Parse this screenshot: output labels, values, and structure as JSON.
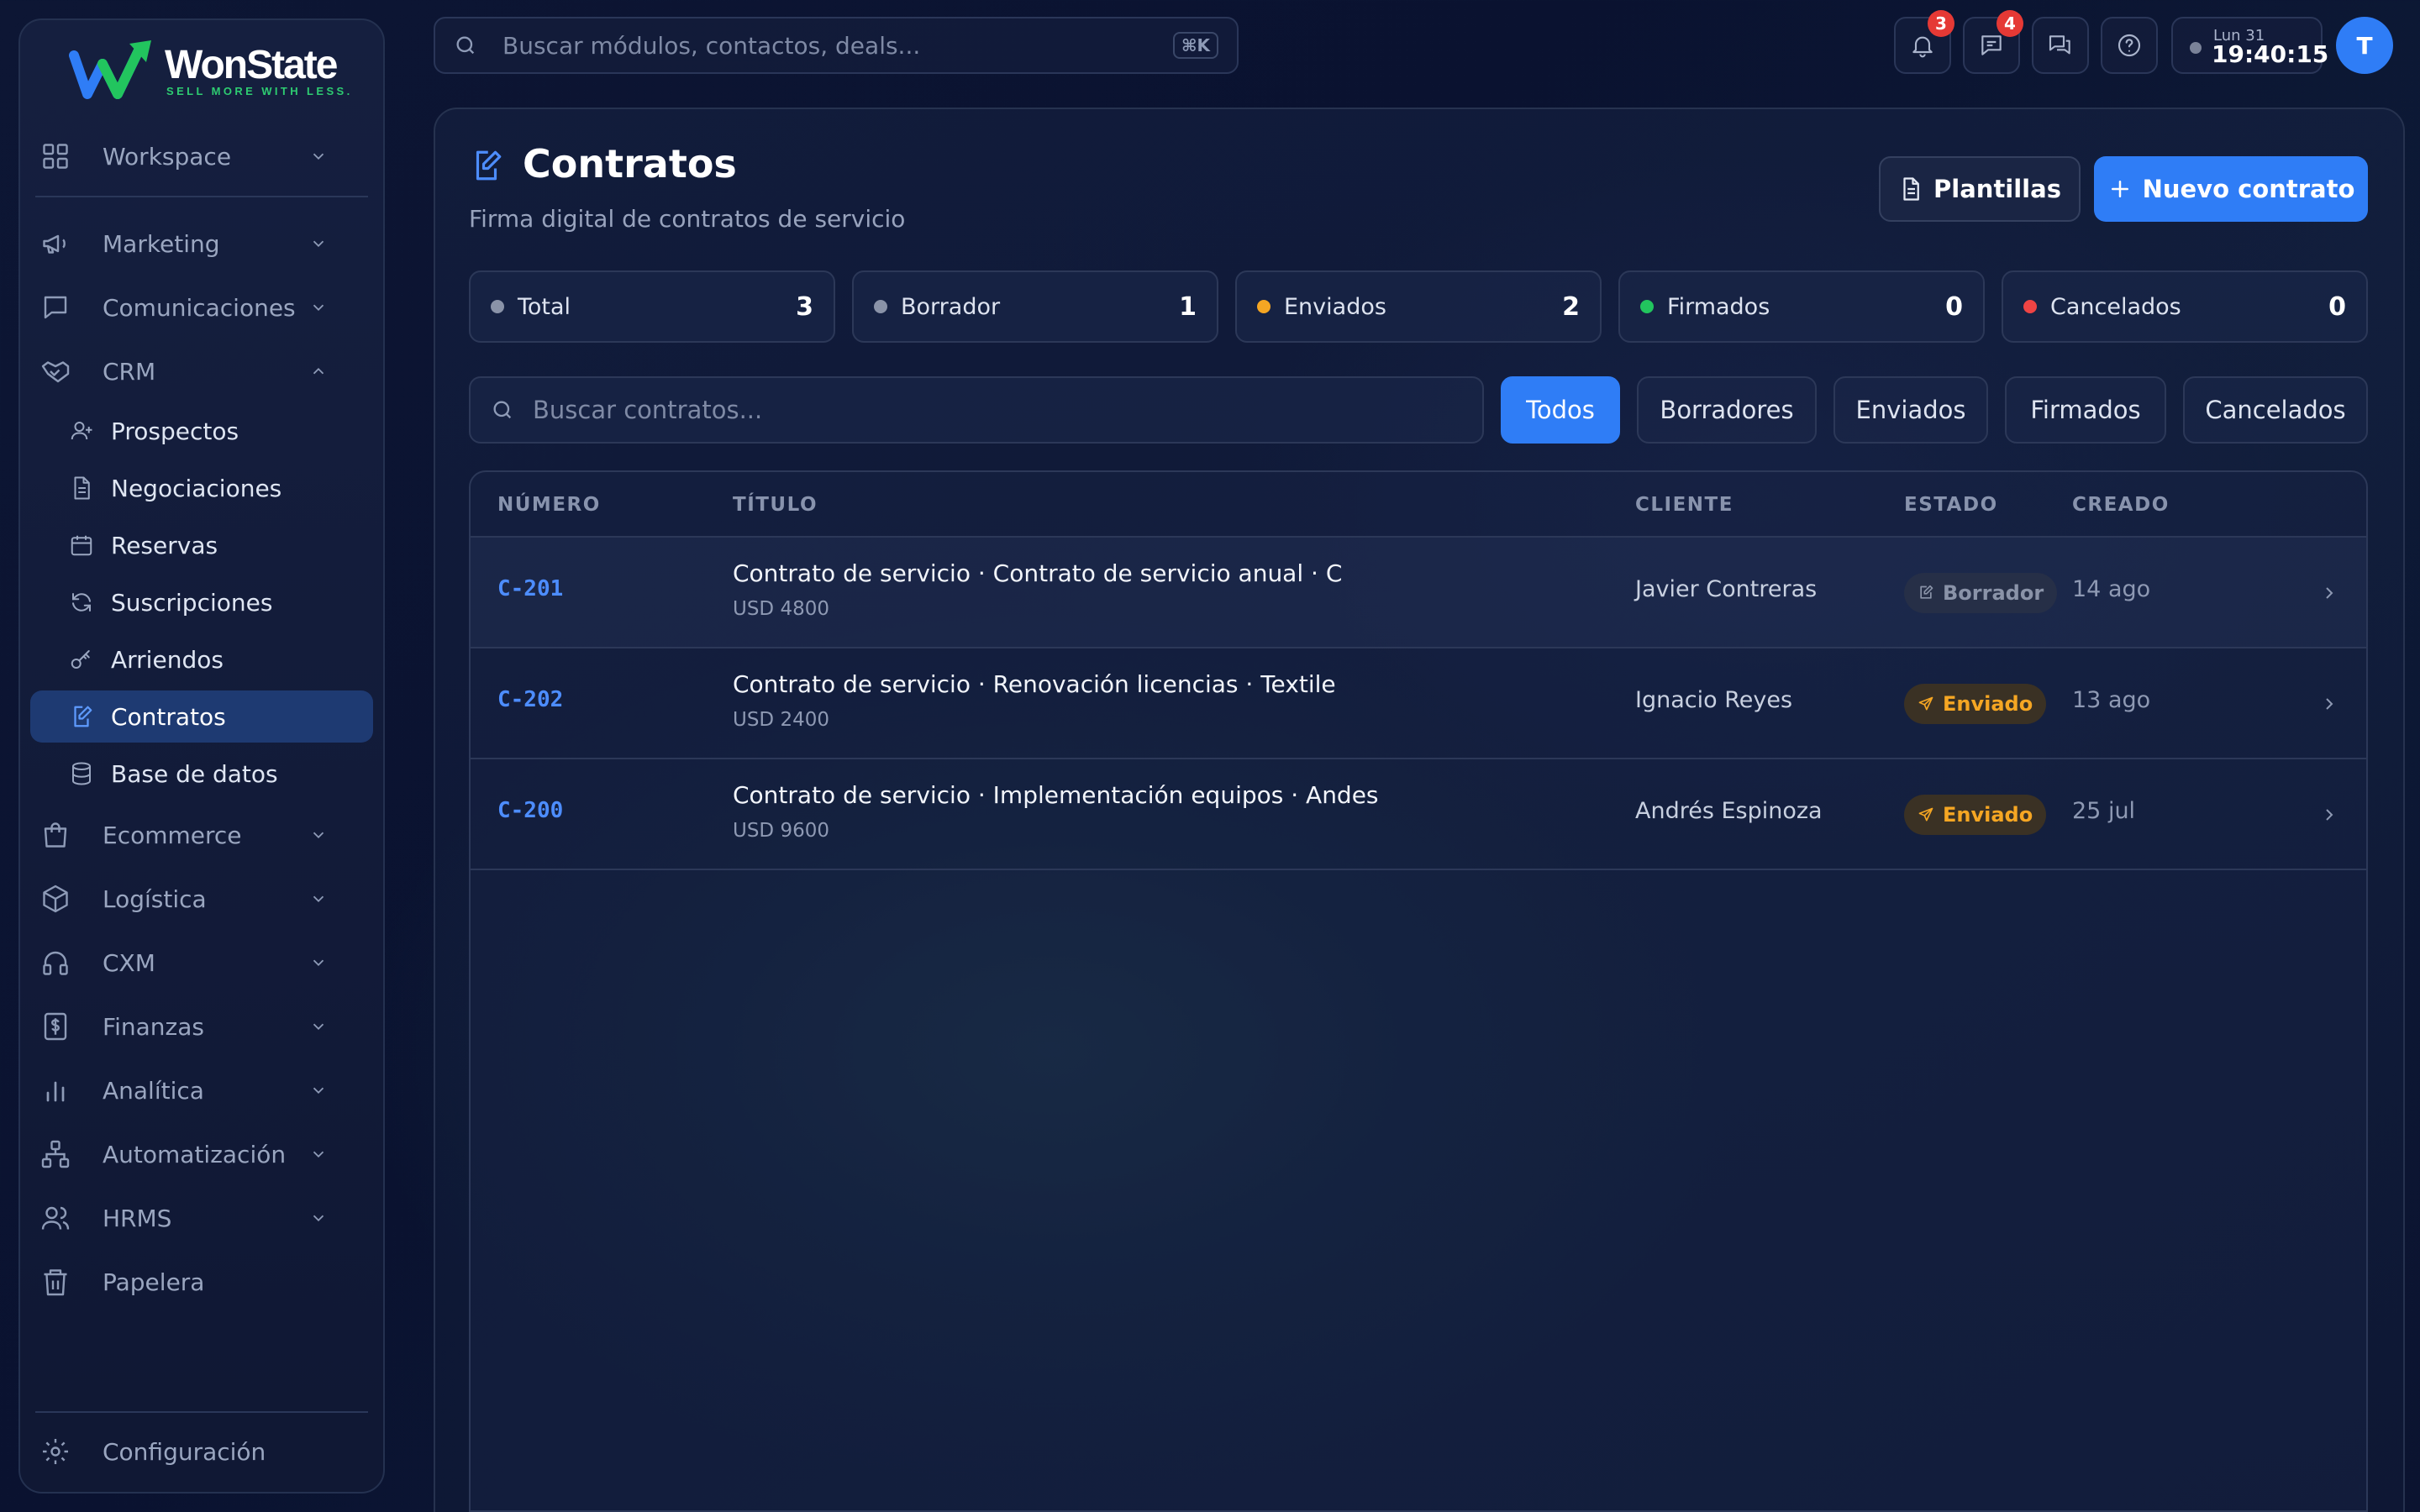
{
  "brand": {
    "name": "WonState",
    "tagline": "SELL MORE WITH LESS."
  },
  "colors": {
    "accent": "#2f7df6",
    "active_nav": "#1e3a72",
    "status_draft": "#8a93a8",
    "status_sent": "#f5a623",
    "status_signed": "#22c55e",
    "status_cancelled": "#ef4444",
    "badge": "#e53935"
  },
  "sidebar": {
    "workspace": "Workspace",
    "groups_top": [
      "Marketing",
      "Comunicaciones",
      "CRM"
    ],
    "crm_items": [
      "Prospectos",
      "Negociaciones",
      "Reservas",
      "Suscripciones",
      "Arriendos",
      "Contratos",
      "Base de datos"
    ],
    "groups_bottom": [
      "Ecommerce",
      "Logística",
      "CXM",
      "Finanzas",
      "Analítica",
      "Automatización",
      "HRMS",
      "Papelera"
    ],
    "settings": "Configuración",
    "active_item": "Contratos"
  },
  "topbar": {
    "search_placeholder": "Buscar módulos, contactos, deals...",
    "shortcut": "⌘K",
    "notifications_count": "3",
    "messages_count": "4",
    "clock_day": "Lun 31",
    "clock_time": "19:40:15",
    "avatar_initial": "T",
    "icons": [
      "bell-icon",
      "chat-icon",
      "chats-icon",
      "help-icon"
    ]
  },
  "page": {
    "title": "Contratos",
    "subtitle": "Firma digital de contratos de servicio",
    "templates_button": "Plantillas",
    "new_button": "Nuevo contrato"
  },
  "stats": [
    {
      "label": "Total",
      "value": "3",
      "color": "#8a93a8"
    },
    {
      "label": "Borrador",
      "value": "1",
      "color": "#8a93a8"
    },
    {
      "label": "Enviados",
      "value": "2",
      "color": "#f5a623"
    },
    {
      "label": "Firmados",
      "value": "0",
      "color": "#22c55e"
    },
    {
      "label": "Cancelados",
      "value": "0",
      "color": "#ef4444"
    }
  ],
  "filters": {
    "search_placeholder": "Buscar contratos...",
    "options": [
      "Todos",
      "Borradores",
      "Enviados",
      "Firmados",
      "Cancelados"
    ],
    "selected": "Todos"
  },
  "table": {
    "columns": [
      "NÚMERO",
      "TÍTULO",
      "CLIENTE",
      "ESTADO",
      "CREADO"
    ],
    "rows": [
      {
        "number": "C-201",
        "title": "Contrato de servicio · Contrato de servicio anual · C",
        "amount": "USD 4800",
        "client": "Javier Contreras",
        "status": "Borrador",
        "created": "14 ago"
      },
      {
        "number": "C-202",
        "title": "Contrato de servicio · Renovación licencias · Textile",
        "amount": "USD 2400",
        "client": "Ignacio Reyes",
        "status": "Enviado",
        "created": "13 ago"
      },
      {
        "number": "C-200",
        "title": "Contrato de servicio · Implementación equipos · Andes",
        "amount": "USD 9600",
        "client": "Andrés Espinoza",
        "status": "Enviado",
        "created": "25 jul"
      }
    ]
  }
}
